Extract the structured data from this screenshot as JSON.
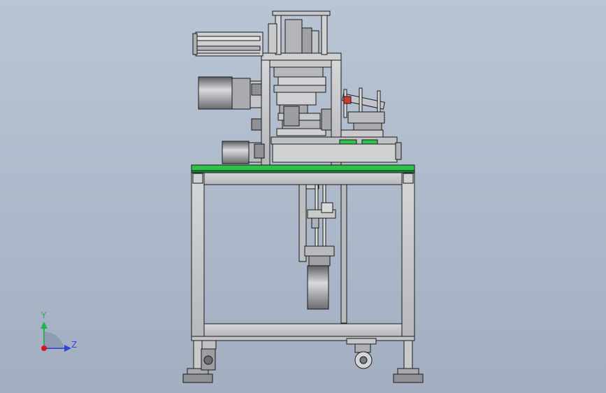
{
  "viewport": {
    "background_top": "#b9c4d4",
    "background_bottom": "#a3afc1",
    "line_color": "#1a1a1a",
    "metal_color": "#c8c9cb",
    "metal_dark": "#8e9095",
    "accent_green": "#2ec24a"
  },
  "triad": {
    "y_label": "Y",
    "z_label": "Z",
    "y_color": "#22b14c",
    "z_color": "#2f47d9",
    "x_color": "#d11a1a"
  }
}
